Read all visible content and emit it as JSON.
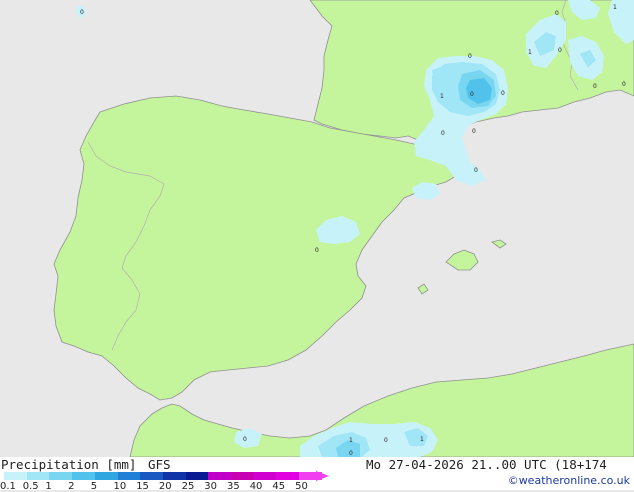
{
  "title": {
    "label": "Precipitation [mm]",
    "model": "GFS",
    "datetime": "Mo 27-04-2026 21..00 UTC (18+174"
  },
  "credit": "©weatheronline.co.uk",
  "colors": {
    "sea": "#e8e8e8",
    "land": "#c4f59c",
    "coast": "#909090",
    "border": "#b0b0b0"
  },
  "legend": {
    "items": [
      {
        "label": "0.1",
        "color": "#c8f2fa"
      },
      {
        "label": "0.5",
        "color": "#a0e6f6"
      },
      {
        "label": "1",
        "color": "#78d6f0"
      },
      {
        "label": "2",
        "color": "#50c2ec"
      },
      {
        "label": "5",
        "color": "#30a6e0"
      },
      {
        "label": "10",
        "color": "#2080d8"
      },
      {
        "label": "15",
        "color": "#1858c0"
      },
      {
        "label": "20",
        "color": "#1034a8"
      },
      {
        "label": "25",
        "color": "#0a1a90"
      },
      {
        "label": "30",
        "color": "#c000c8"
      },
      {
        "label": "35",
        "color": "#c800b4"
      },
      {
        "label": "40",
        "color": "#d000d0"
      },
      {
        "label": "45",
        "color": "#e000e0"
      },
      {
        "label": "50",
        "color": "#f040f0"
      }
    ]
  },
  "value_labels": [
    "0",
    "0",
    "0",
    "1",
    "1",
    "1",
    "0",
    "0",
    "0",
    "0",
    "0",
    "0",
    "0",
    "0",
    "0",
    "1",
    "0",
    "1",
    "0",
    "0"
  ]
}
